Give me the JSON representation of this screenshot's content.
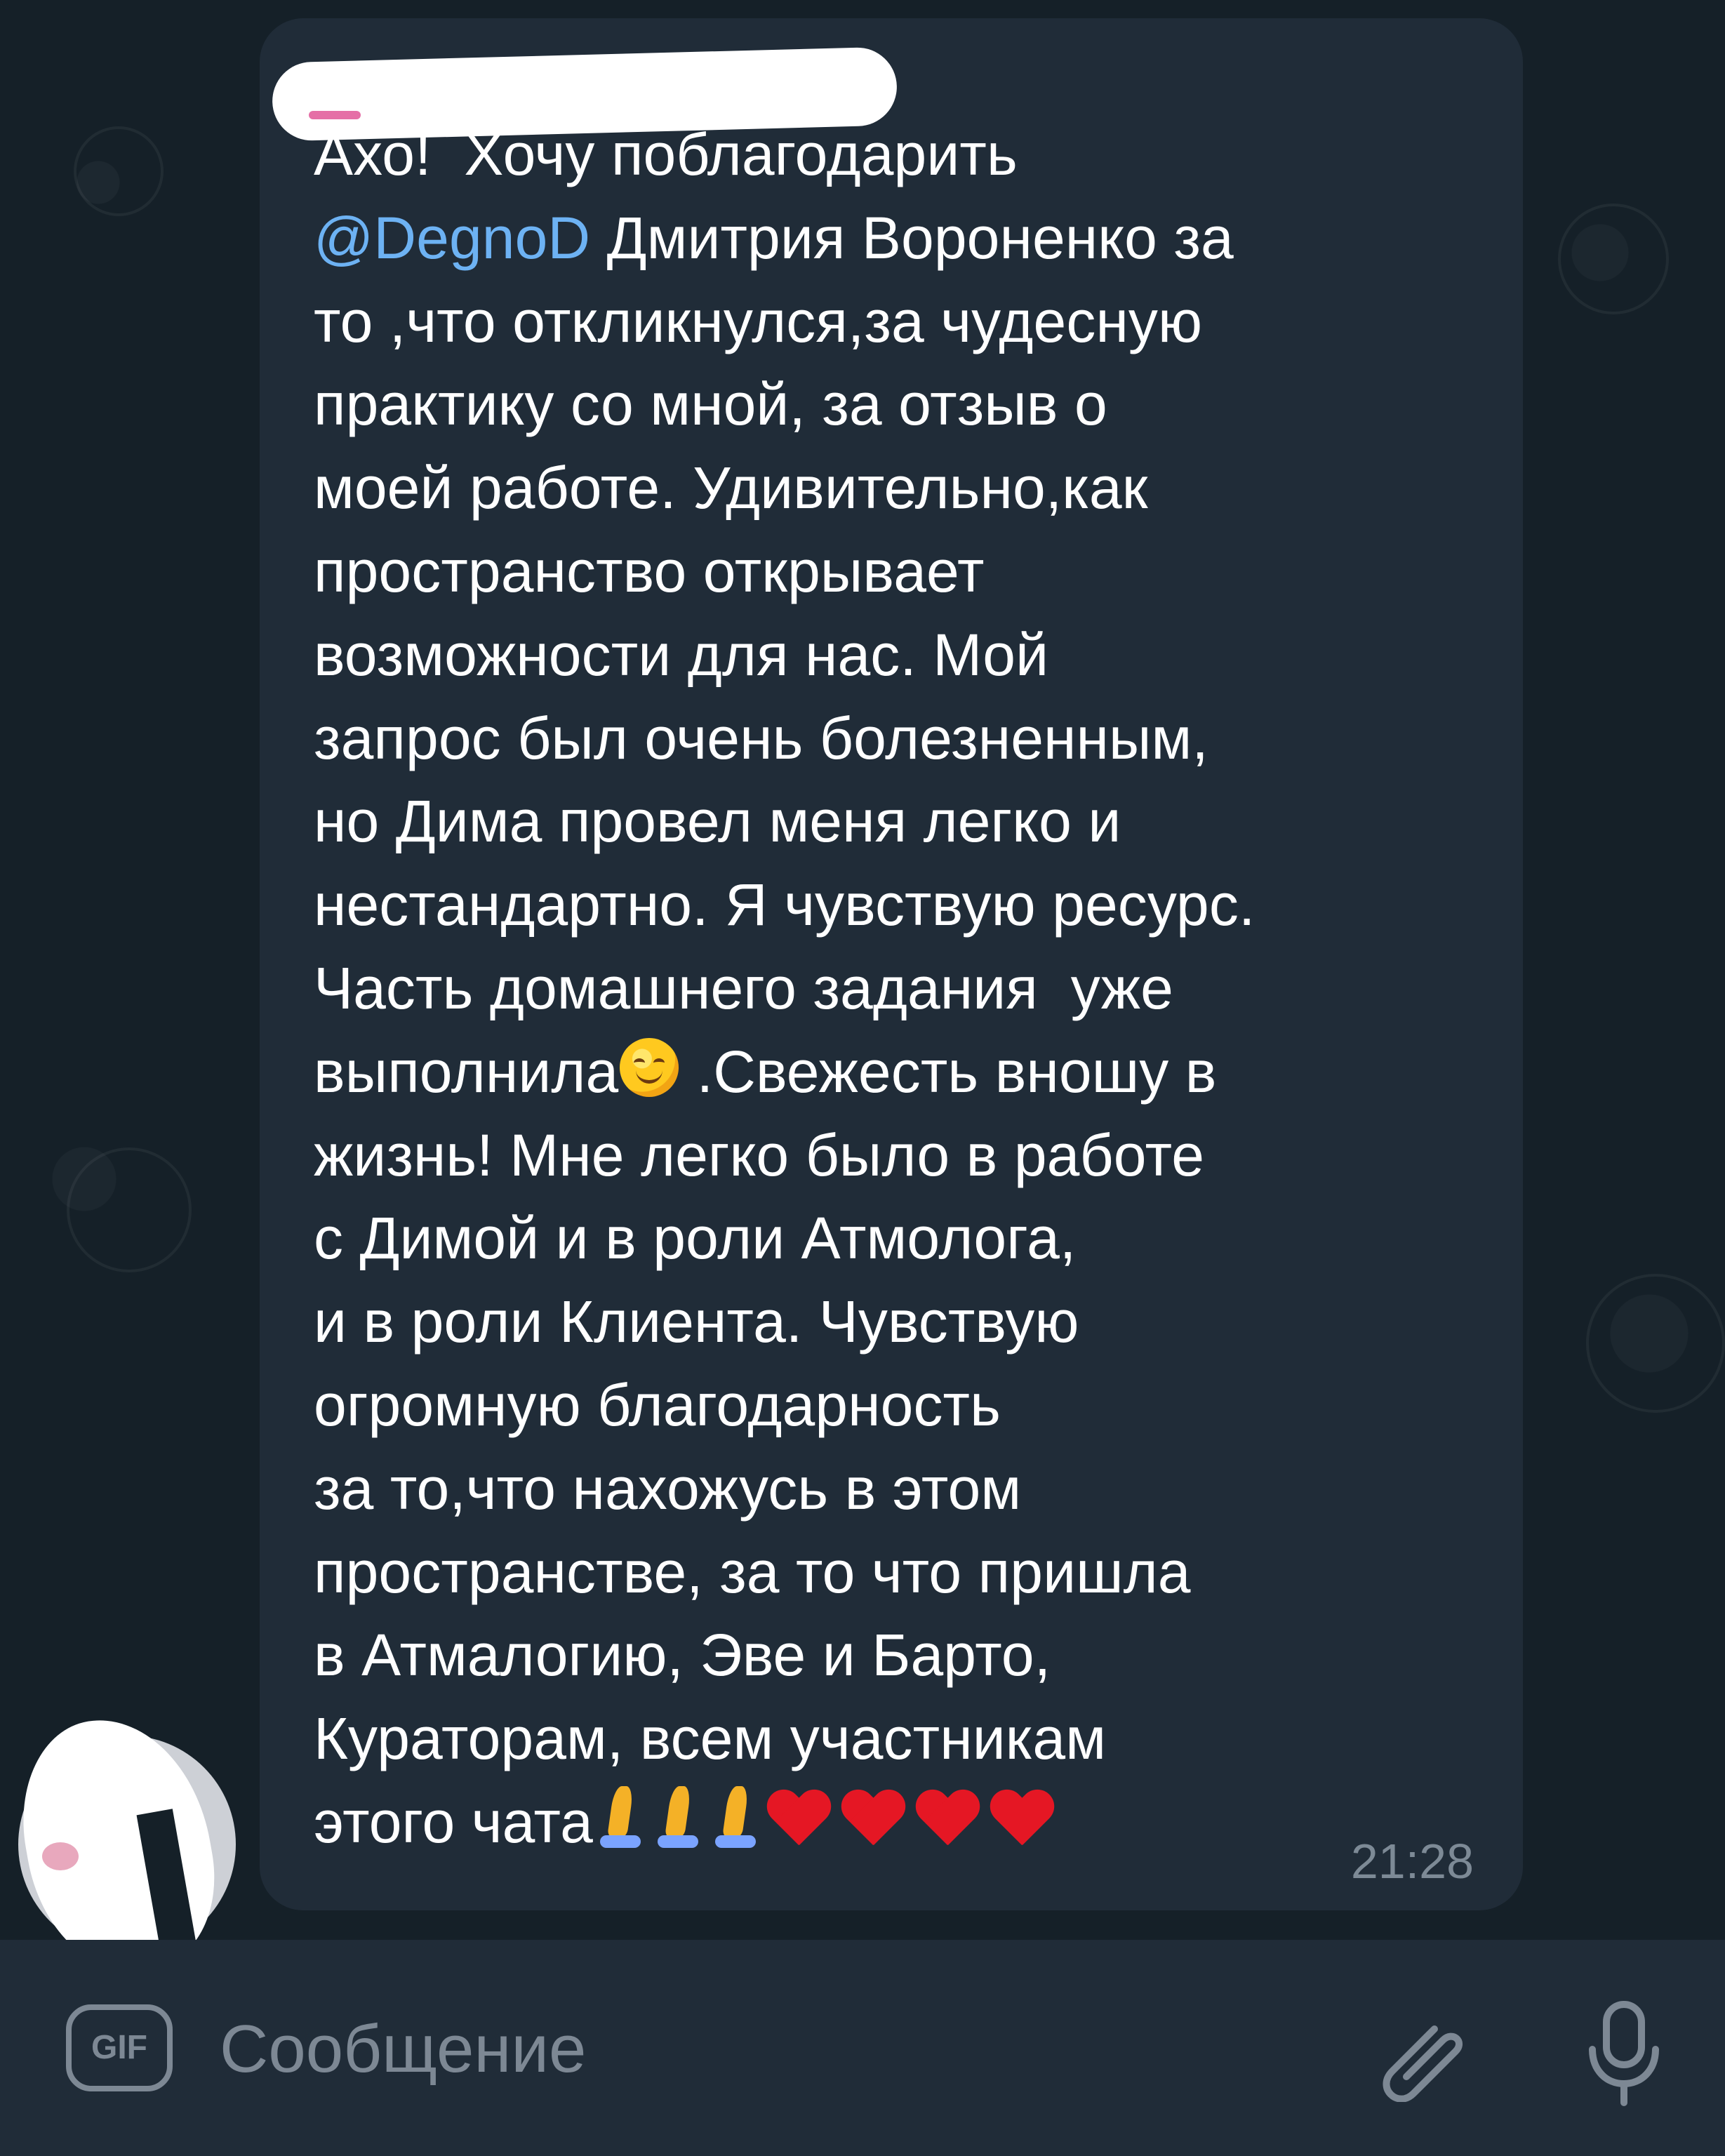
{
  "message": {
    "before_mention": "Ахо!  Хочу поблагодарить\n",
    "mention": "@DegnoD",
    "after_mention": " Дмитрия Вороненко за\nто ,что откликнулся,за чудесную\nпрактику со мной, за отзыв о\nмоей работе. Удивительно,как\nпространство открывает\nвозможности для нас. Мой\nзапрос был очень болезненным,\nно Дима провел меня легко и\nнестандартно. Я чувствую ресурс.\nЧасть домашнего задания  уже\nвыполнила",
    "after_smile": " .Свежесть вношу в\nжизнь! Мне легко было в работе\nс Димой и в роли Атмолога,\nи в роли Клиента. Чувствую\nогромную благодарность\nза то,что нахожусь в этом\nпространстве, за то что пришла\nв Атмалогию, Эве и Барто,\nКураторам, всем участникам\nэтого чата",
    "time": "21:28",
    "emoji_smile": "smiling-face-emoji",
    "emoji_prayers": [
      "folded-hands-emoji",
      "folded-hands-emoji",
      "folded-hands-emoji"
    ],
    "emoji_hearts": [
      "red-heart-emoji",
      "red-heart-emoji",
      "red-heart-emoji",
      "red-heart-emoji"
    ]
  },
  "composer": {
    "gif_label": "GIF",
    "placeholder": "Сообщение",
    "attach_icon": "paperclip-icon",
    "mic_icon": "microphone-icon"
  },
  "colors": {
    "background": "#152028",
    "bubble": "#202c38",
    "text": "#ffffff",
    "mention": "#6db2f3",
    "muted": "#7d8894"
  }
}
